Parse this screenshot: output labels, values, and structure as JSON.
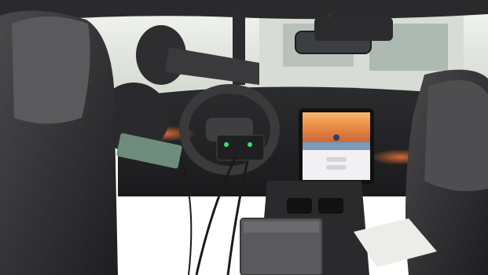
{
  "scene": {
    "kind": "photograph",
    "subject": "car-interior-test-rig"
  },
  "colors": {
    "cabin_dark": "#1c1c1e",
    "window_bright": "#e8ece6",
    "ambient_orange": "#d8502a",
    "display_sky": "#f0a050",
    "display_road": "#7a9ab8",
    "indicator_green": "#39e070"
  },
  "center_display": {
    "buttons": [
      "",
      ""
    ]
  }
}
